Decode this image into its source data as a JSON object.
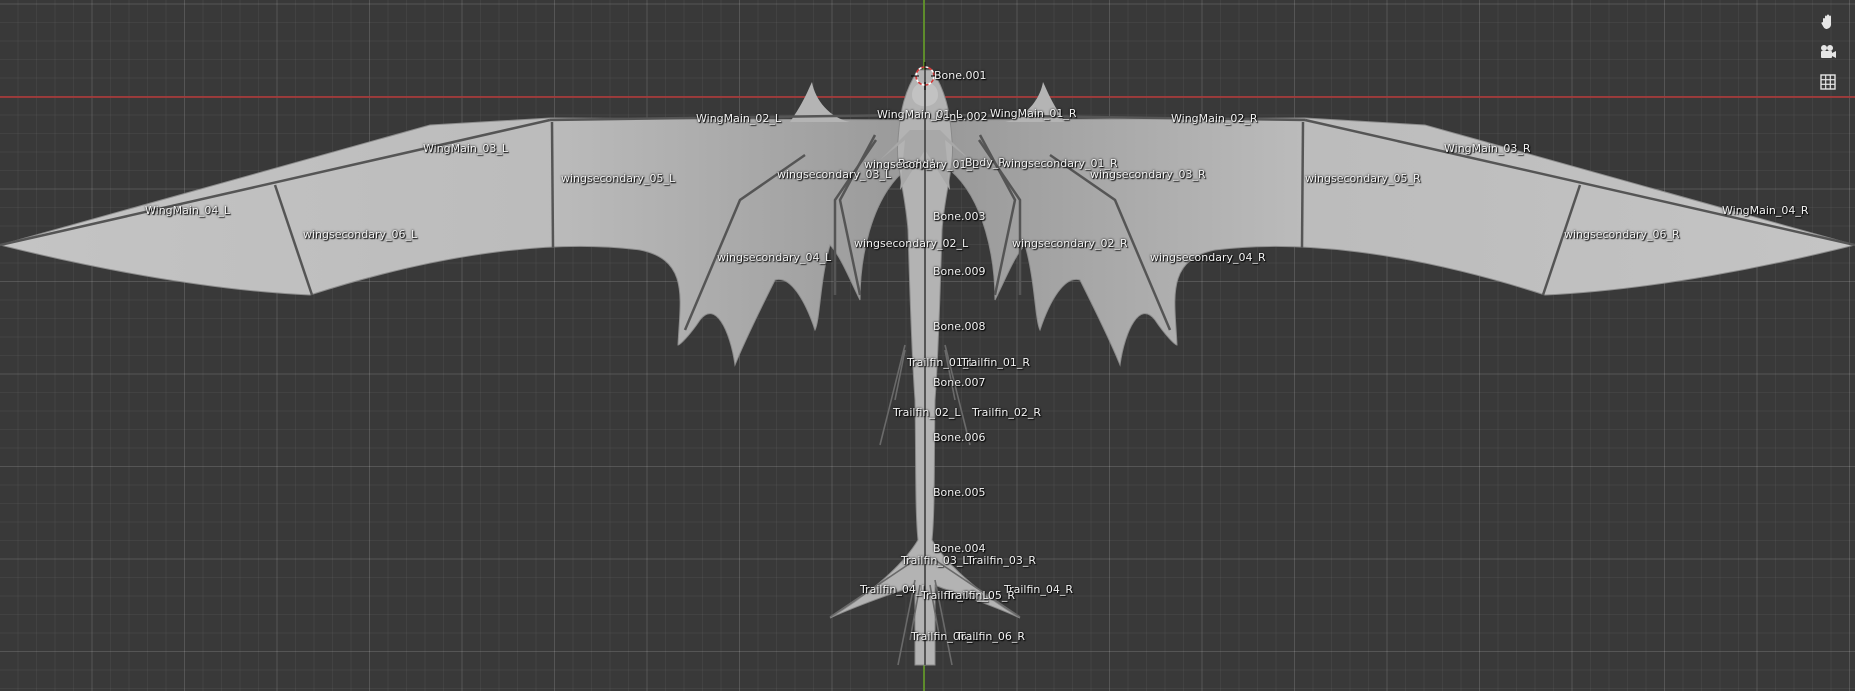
{
  "viewport": {
    "axis_colors": {
      "x": "#a33a3a",
      "y": "#5f8f2a"
    },
    "background": "#393939"
  },
  "model": {
    "color": "#b8b8b8",
    "bones": [
      {
        "id": "bone_001",
        "label": "Bone.001"
      },
      {
        "id": "bone_002",
        "label": "Bone.002"
      },
      {
        "id": "bone_003",
        "label": "Bone.003"
      },
      {
        "id": "bone_004",
        "label": "Bone.004"
      },
      {
        "id": "bone_005",
        "label": "Bone.005"
      },
      {
        "id": "bone_006",
        "label": "Bone.006"
      },
      {
        "id": "bone_007",
        "label": "Bone.007"
      },
      {
        "id": "bone_008",
        "label": "Bone.008"
      },
      {
        "id": "bone_009",
        "label": "Bone.009"
      },
      {
        "id": "body_l",
        "label": "Body_L"
      },
      {
        "id": "body_r",
        "label": "Body_R"
      },
      {
        "id": "wingmain_01_l",
        "label": "WingMain_01_L"
      },
      {
        "id": "wingmain_01_r",
        "label": "WingMain_01_R"
      },
      {
        "id": "wingmain_02_l",
        "label": "WingMain_02_L"
      },
      {
        "id": "wingmain_02_r",
        "label": "WingMain_02_R"
      },
      {
        "id": "wingmain_03_l",
        "label": "WingMain_03_L"
      },
      {
        "id": "wingmain_03_r",
        "label": "WingMain_03_R"
      },
      {
        "id": "wingmain_04_l",
        "label": "WingMain_04_L"
      },
      {
        "id": "wingmain_04_r",
        "label": "WingMain_04_R"
      },
      {
        "id": "wingsecondary_01_l",
        "label": "wingsecondary_01_L"
      },
      {
        "id": "wingsecondary_01_r",
        "label": "wingsecondary_01_R"
      },
      {
        "id": "wingsecondary_02_l",
        "label": "wingsecondary_02_L"
      },
      {
        "id": "wingsecondary_02_r",
        "label": "wingsecondary_02_R"
      },
      {
        "id": "wingsecondary_03_l",
        "label": "wingsecondary_03_L"
      },
      {
        "id": "wingsecondary_03_r",
        "label": "wingsecondary_03_R"
      },
      {
        "id": "wingsecondary_04_l",
        "label": "wingsecondary_04_L"
      },
      {
        "id": "wingsecondary_04_r",
        "label": "wingsecondary_04_R"
      },
      {
        "id": "wingsecondary_05_l",
        "label": "wingsecondary_05_L"
      },
      {
        "id": "wingsecondary_05_r",
        "label": "wingsecondary_05_R"
      },
      {
        "id": "wingsecondary_06_l",
        "label": "wingsecondary_06_L"
      },
      {
        "id": "wingsecondary_06_r",
        "label": "wingsecondary_06_R"
      },
      {
        "id": "trailfin_01_l",
        "label": "Trailfin_01_L"
      },
      {
        "id": "trailfin_01_r",
        "label": "Trailfin_01_R"
      },
      {
        "id": "trailfin_02_l",
        "label": "Trailfin_02_L"
      },
      {
        "id": "trailfin_02_r",
        "label": "Trailfin_02_R"
      },
      {
        "id": "trailfin_03_l",
        "label": "Trailfin_03_L"
      },
      {
        "id": "trailfin_03_r",
        "label": "Trailfin_03_R"
      },
      {
        "id": "trailfin_04_l",
        "label": "Trailfin_04_L"
      },
      {
        "id": "trailfin_04_r",
        "label": "Trailfin_04_R"
      },
      {
        "id": "trailfin_05_l",
        "label": "Trailfin_05_L"
      },
      {
        "id": "trailfin_05_r",
        "label": "Trailfin_05_R"
      },
      {
        "id": "trailfin_06_l",
        "label": "Trailfin_06_L"
      },
      {
        "id": "trailfin_06_r",
        "label": "Trailfin_06_R"
      }
    ]
  },
  "nav_gizmo": {
    "buttons": [
      {
        "id": "pan",
        "icon": "hand-icon"
      },
      {
        "id": "camera",
        "icon": "camera-icon"
      },
      {
        "id": "ortho",
        "icon": "grid-icon"
      }
    ]
  }
}
